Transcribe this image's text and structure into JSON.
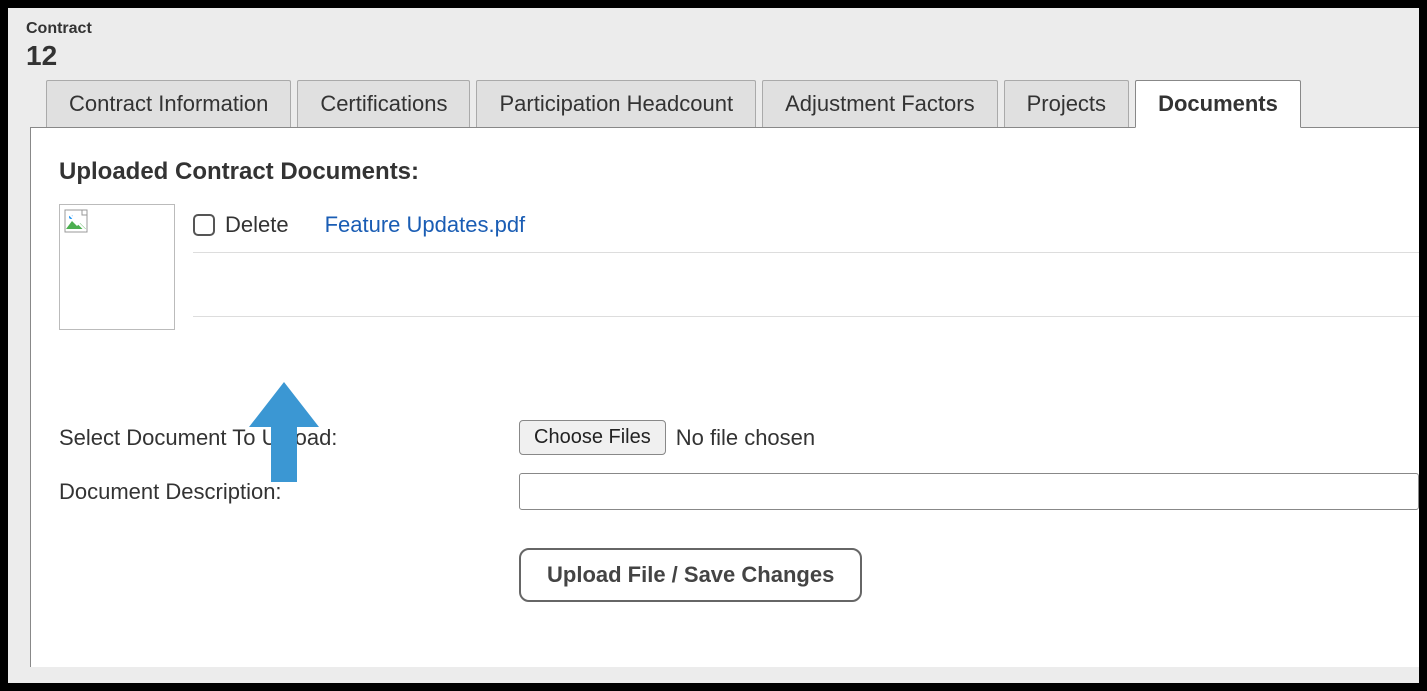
{
  "header": {
    "label": "Contract",
    "number": "12"
  },
  "tabs": [
    {
      "label": "Contract Information",
      "active": false
    },
    {
      "label": "Certifications",
      "active": false
    },
    {
      "label": "Participation Headcount",
      "active": false
    },
    {
      "label": "Adjustment Factors",
      "active": false
    },
    {
      "label": "Projects",
      "active": false
    },
    {
      "label": "Documents",
      "active": true
    }
  ],
  "documents": {
    "heading": "Uploaded Contract Documents:",
    "rows": [
      {
        "delete_label": "Delete",
        "filename": "Feature Updates.pdf"
      }
    ]
  },
  "upload_form": {
    "select_label": "Select Document To Upload:",
    "choose_button": "Choose Files",
    "file_status": "No file chosen",
    "description_label": "Document Description:",
    "description_value": "",
    "submit_button": "Upload File / Save Changes"
  },
  "colors": {
    "link": "#1a5db4",
    "arrow": "#3b97d3"
  }
}
